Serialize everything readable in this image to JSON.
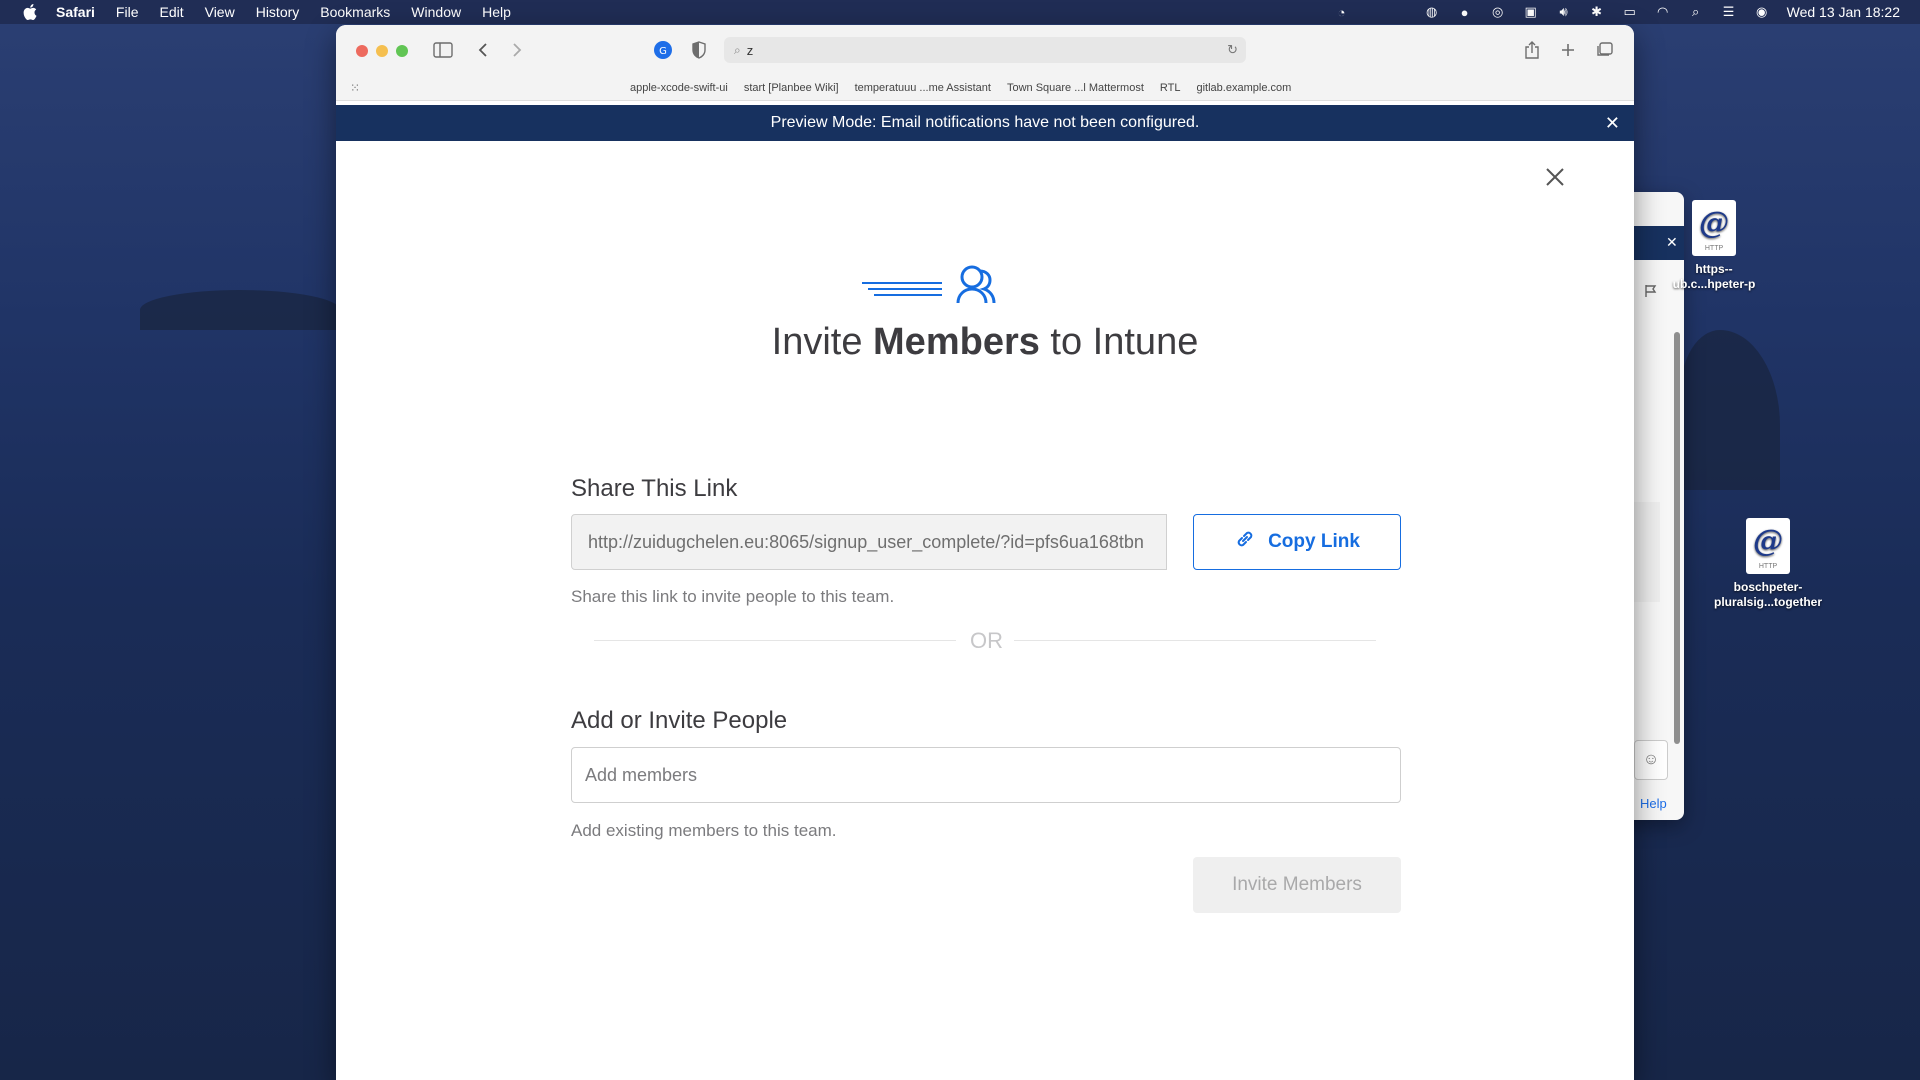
{
  "menubar": {
    "app": "Safari",
    "items": [
      "File",
      "Edit",
      "View",
      "History",
      "Bookmarks",
      "Window",
      "Help"
    ],
    "clock": "Wed 13 Jan  18:22"
  },
  "browser": {
    "address": "z",
    "favorites": [
      "apple-xcode-swift-ui",
      "start [Planbee Wiki]",
      "temperatuuu ...me Assistant",
      "Town Square ...l Mattermost",
      "RTL",
      "gitlab.example.com"
    ]
  },
  "banner": {
    "text": "Preview Mode: Email notifications have not been configured."
  },
  "modal": {
    "title_pre": "Invite ",
    "title_bold": "Members",
    "title_post": " to Intune",
    "share_heading": "Share This Link",
    "share_link": "http://zuidugchelen.eu:8065/signup_user_complete/?id=pfs6ua168tbn",
    "copy_label": "Copy Link",
    "share_helper": "Share this link to invite people to this team.",
    "or_text": "OR",
    "add_heading": "Add or Invite People",
    "add_placeholder": "Add members",
    "add_helper": "Add existing members to this team.",
    "invite_label": "Invite Members"
  },
  "back_window": {
    "help_label": "Help"
  },
  "desktop": {
    "files": [
      {
        "badge": "HTTP",
        "label": "https--\nub.c...hpeter-p"
      },
      {
        "badge": "HTTP",
        "label": "boschpeter-\npluralsig...together"
      }
    ]
  },
  "colors": {
    "accent": "#166de0",
    "banner": "#17315f"
  }
}
